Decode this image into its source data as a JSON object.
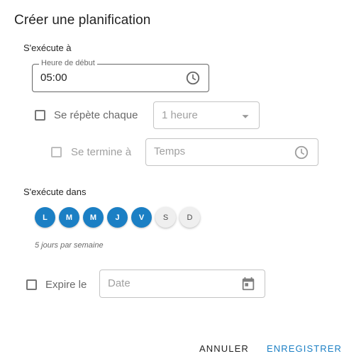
{
  "dialog": {
    "title": "Créer une planification"
  },
  "runs_at": {
    "label": "S'exécute à",
    "start_time_label": "Heure de début",
    "start_time_value": "05:00"
  },
  "repeat": {
    "label": "Se répète chaque",
    "checked": false,
    "interval_placeholder": "1 heure",
    "ends_label": "Se termine à",
    "ends_placeholder": "Temps"
  },
  "runs_in": {
    "label": "S'exécute dans",
    "days": [
      {
        "letter": "L",
        "selected": true
      },
      {
        "letter": "M",
        "selected": true
      },
      {
        "letter": "M",
        "selected": true
      },
      {
        "letter": "J",
        "selected": true
      },
      {
        "letter": "V",
        "selected": true
      },
      {
        "letter": "S",
        "selected": false
      },
      {
        "letter": "D",
        "selected": false
      }
    ],
    "summary": "5 jours par semaine"
  },
  "expires": {
    "label": "Expire le",
    "checked": false,
    "date_placeholder": "Date"
  },
  "actions": {
    "cancel_label": "ANNULER",
    "save_label": "ENREGISTRER"
  },
  "colors": {
    "accent": "#1b7fc4",
    "day_off_bg": "#efefef"
  },
  "icons": {
    "time": "clock-icon",
    "interval_dropdown": "caret-down-icon",
    "end_time": "clock-icon",
    "date": "calendar-icon"
  }
}
